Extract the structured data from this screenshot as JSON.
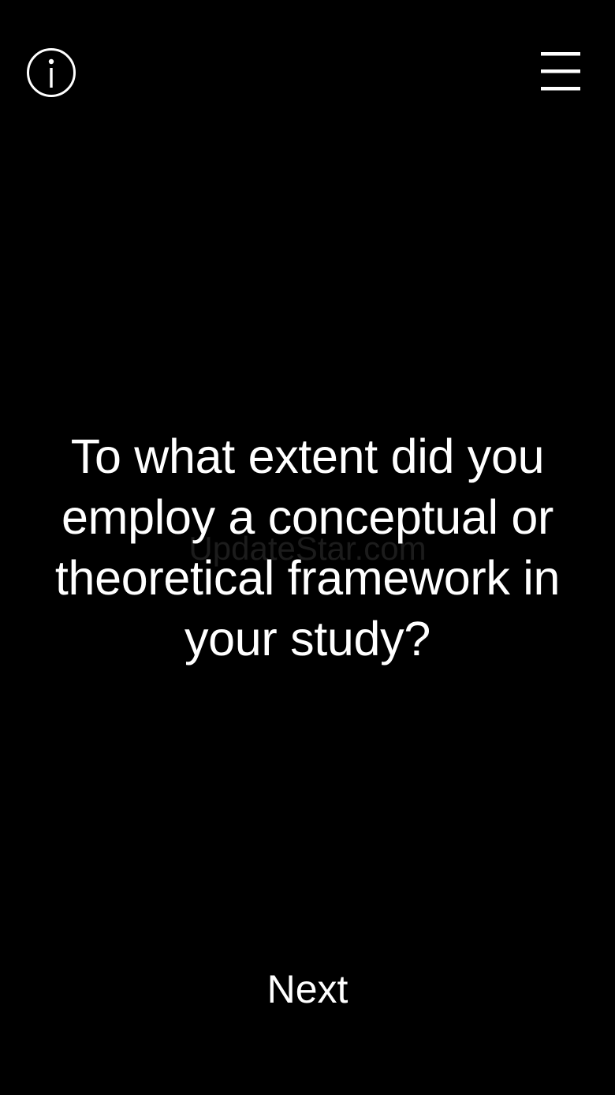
{
  "header": {
    "info_icon": "info-circle-icon",
    "menu_icon": "hamburger-menu-icon"
  },
  "question": {
    "text": "To what extent did you employ a conceptual or theoretical framework in your study?"
  },
  "watermark": {
    "text": "UpdateStar.com"
  },
  "footer": {
    "next_label": "Next"
  },
  "colors": {
    "background": "#000000",
    "foreground": "#ffffff",
    "watermark": "#1c1c1c"
  }
}
